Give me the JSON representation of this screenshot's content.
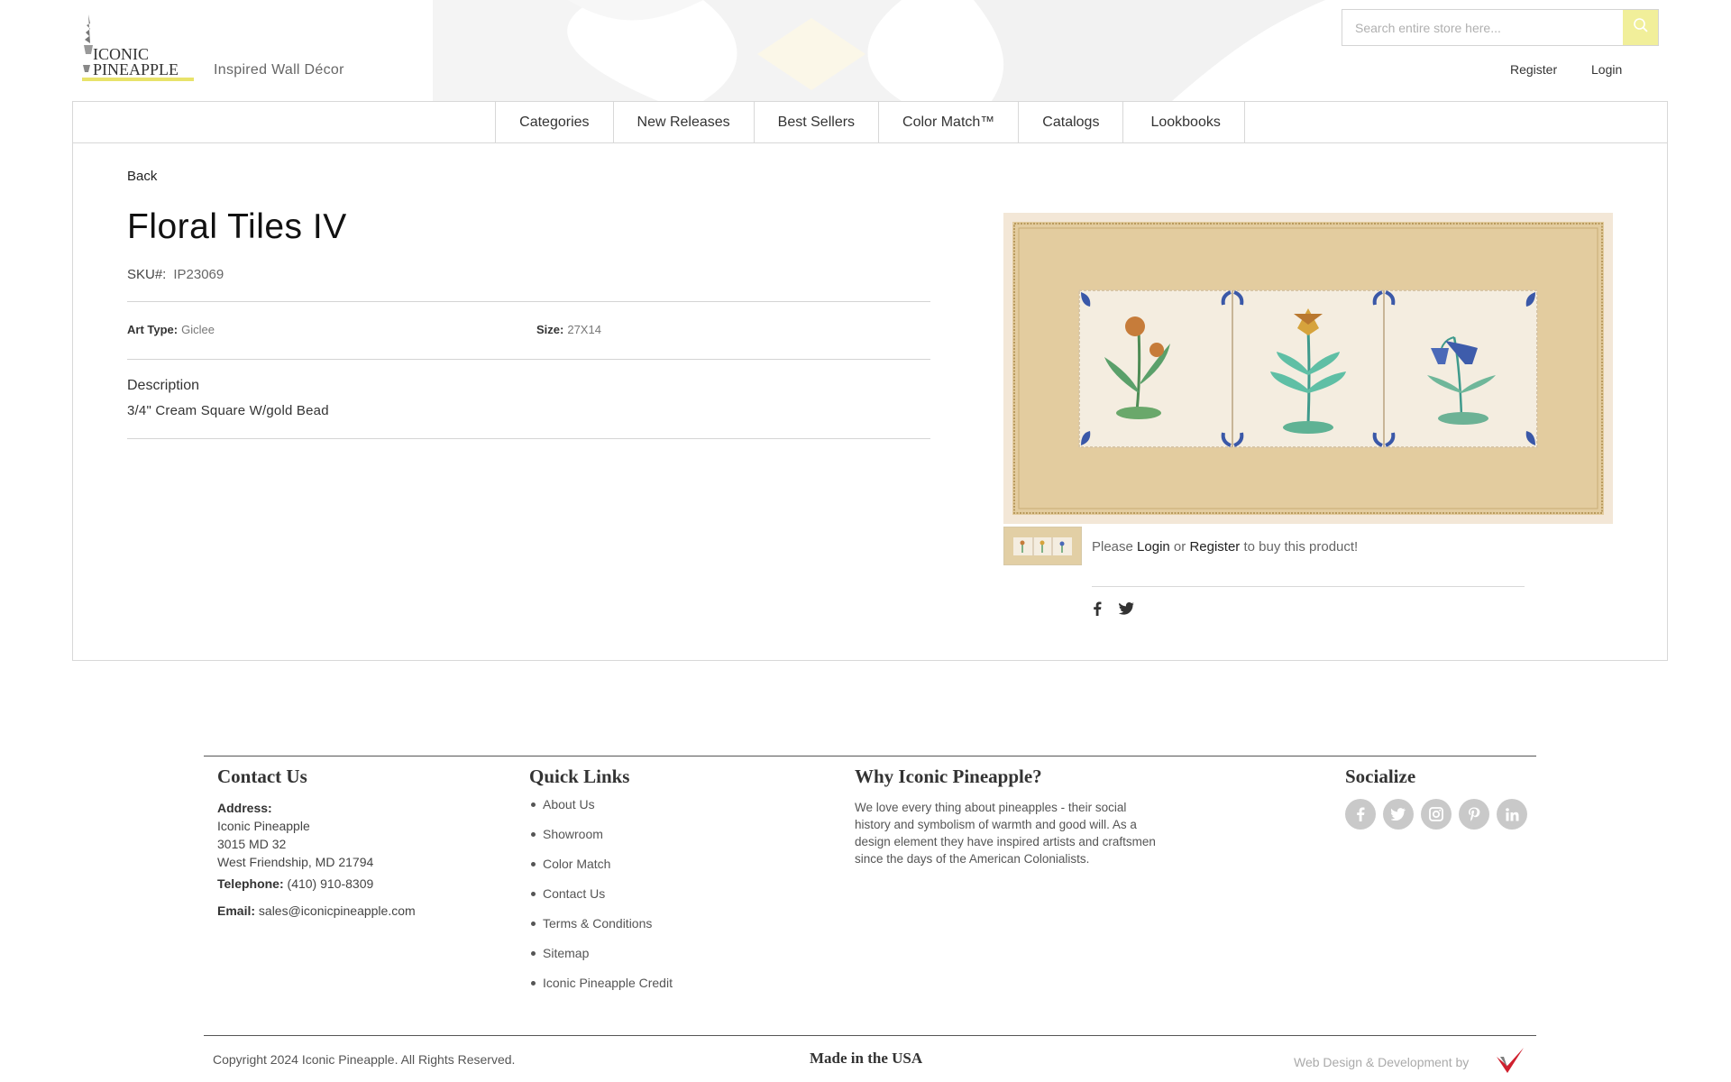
{
  "header": {
    "logo": {
      "line1": "ICONIC",
      "line2": "PINEAPPLE"
    },
    "tagline": "Inspired Wall Décor",
    "search": {
      "placeholder": "Search entire store here..."
    },
    "account": {
      "register": "Register",
      "login": "Login"
    },
    "colors": {
      "accent": "#f1ef9a",
      "logo_bar": "#e8e36a"
    }
  },
  "nav": {
    "items": [
      "Categories",
      "New Releases",
      "Best Sellers",
      "Color Match™",
      "Catalogs",
      "Lookbooks"
    ]
  },
  "product": {
    "back": "Back",
    "title": "Floral Tiles IV",
    "sku_label": "SKU#:",
    "sku": "IP23069",
    "art_type_label": "Art Type:",
    "art_type": "Giclee",
    "size_label": "Size:",
    "size": "27X14",
    "description_heading": "Description",
    "description": "3/4\" Cream Square W/gold Bead",
    "buy_note": {
      "pre": "Please",
      "login": "Login",
      "or": "or",
      "register": "Register",
      "post": "to buy this product!"
    }
  },
  "footer": {
    "contact": {
      "heading": "Contact Us",
      "address_label": "Address:",
      "address_lines": [
        "Iconic Pineapple",
        "3015 MD 32",
        "West Friendship, MD 21794"
      ],
      "telephone_label": "Telephone:",
      "telephone": "(410) 910-8309",
      "email_label": "Email:",
      "email": "sales@iconicpineapple.com"
    },
    "quick_links": {
      "heading": "Quick Links",
      "items": [
        "About Us",
        "Showroom",
        "Color Match",
        "Contact Us",
        "Terms & Conditions",
        "Sitemap",
        "Iconic Pineapple Credit"
      ]
    },
    "why": {
      "heading": "Why Iconic Pineapple?",
      "text": "We love every thing about pineapples - their social history and symbolism of warmth and good will. As a design element they have inspired artists and craftsmen since the days of the American Colonialists."
    },
    "socialize": {
      "heading": "Socialize",
      "icons": [
        "facebook-icon",
        "twitter-icon",
        "instagram-icon",
        "pinterest-icon",
        "linkedin-icon"
      ]
    },
    "copyright": "Copyright 2024 Iconic Pineapple. All Rights Reserved.",
    "made_in": "Made in the USA",
    "credit": "Web Design & Development by"
  }
}
